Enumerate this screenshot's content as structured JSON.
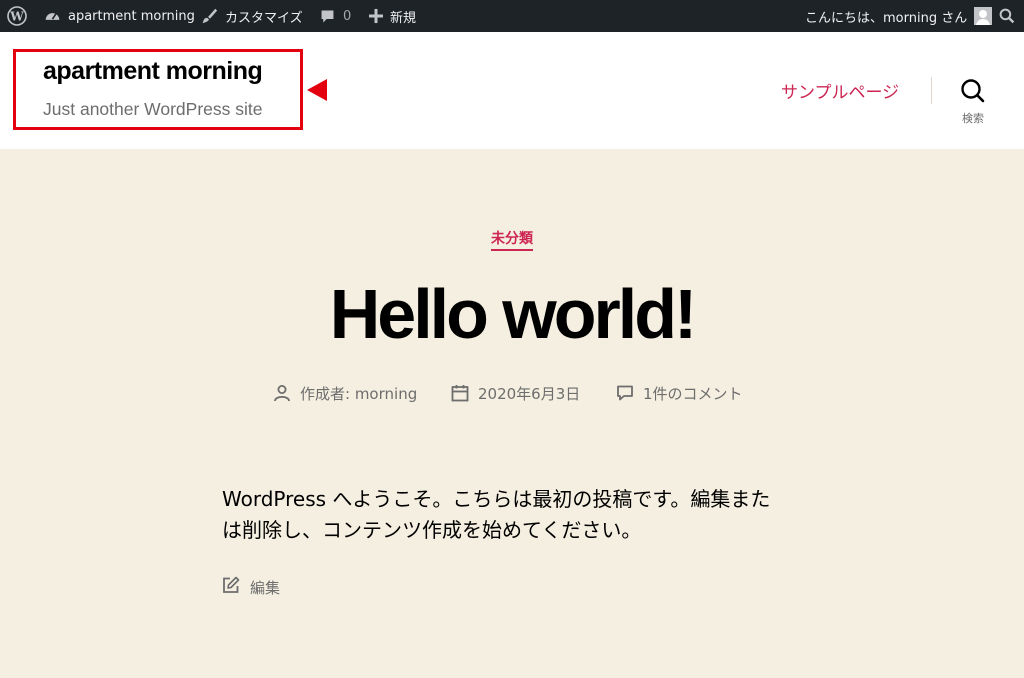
{
  "admin_bar": {
    "wp_logo_icon": "wordpress-logo-icon",
    "site_name": "apartment morning",
    "customize": "カスタマイズ",
    "comments_count": "0",
    "new": "新規",
    "greeting": "こんにちは、morning さん",
    "colors": {
      "background": "#1d2327",
      "text": "#f0f0f1"
    }
  },
  "header": {
    "site_title": "apartment morning",
    "site_description": "Just another WordPress site",
    "nav": [
      {
        "label": "サンプルページ"
      }
    ],
    "search_label": "検索",
    "highlight_color": "#e3000f",
    "accent_color": "#cd2653"
  },
  "post": {
    "category": "未分類",
    "title": "Hello world!",
    "author": "作成者: morning",
    "date": "2020年6月3日",
    "comments": "1件のコメント",
    "content_line1": "WordPress へようこそ。こちらは最初の投稿です。編集また",
    "content_line2": "は削除し、コンテンツ作成を始めてください。",
    "edit": "編集",
    "background": "#f4efe0"
  }
}
